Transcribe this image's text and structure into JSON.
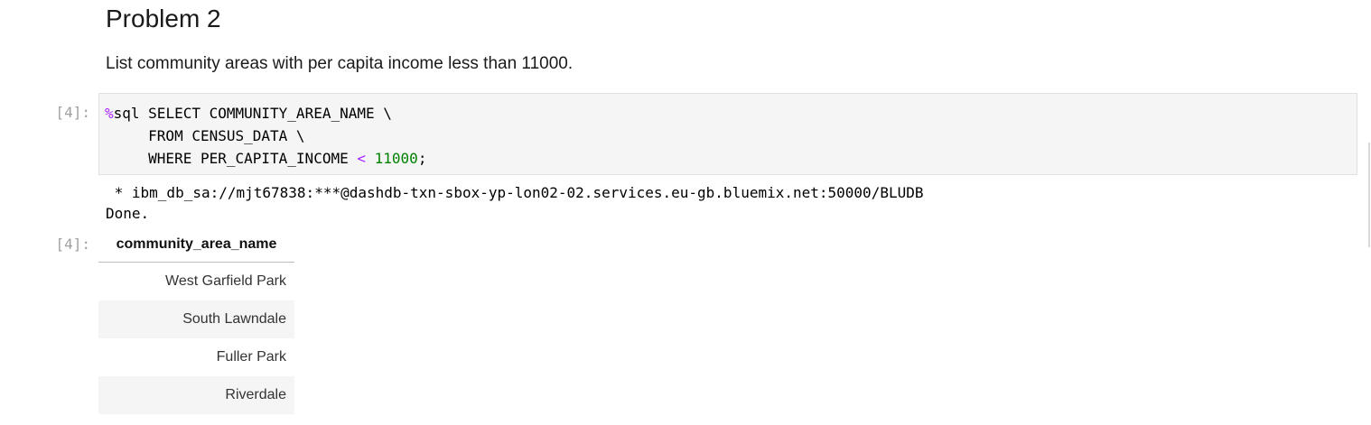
{
  "markdown": {
    "heading": "Problem 2",
    "paragraph": "List community areas with per capita income less than 11000."
  },
  "cell": {
    "input_prompt": "[4]:",
    "output_prompt": "[4]:",
    "code": {
      "line1_magic": "%",
      "line1_rest": "sql SELECT COMMUNITY_AREA_NAME \\",
      "line2": "     FROM CENSUS_DATA \\",
      "line3_prefix": "     WHERE PER_CAPITA_INCOME ",
      "line3_operator": "<",
      "line3_number": "11000",
      "line3_suffix": ";"
    },
    "stdout": {
      "connection": " * ibm_db_sa://mjt67838:***@dashdb-txn-sbox-yp-lon02-02.services.eu-gb.bluemix.net:50000/BLUDB",
      "status": "Done."
    }
  },
  "result_table": {
    "header": "community_area_name",
    "rows": [
      "West Garfield Park",
      "South Lawndale",
      "Fuller Park",
      "Riverdale"
    ]
  },
  "colors": {
    "magic": "#aa22ff",
    "operator": "#aa22ff",
    "number": "#008000",
    "prompt": "#a0a0a0",
    "cell_background": "#f5f5f5"
  }
}
